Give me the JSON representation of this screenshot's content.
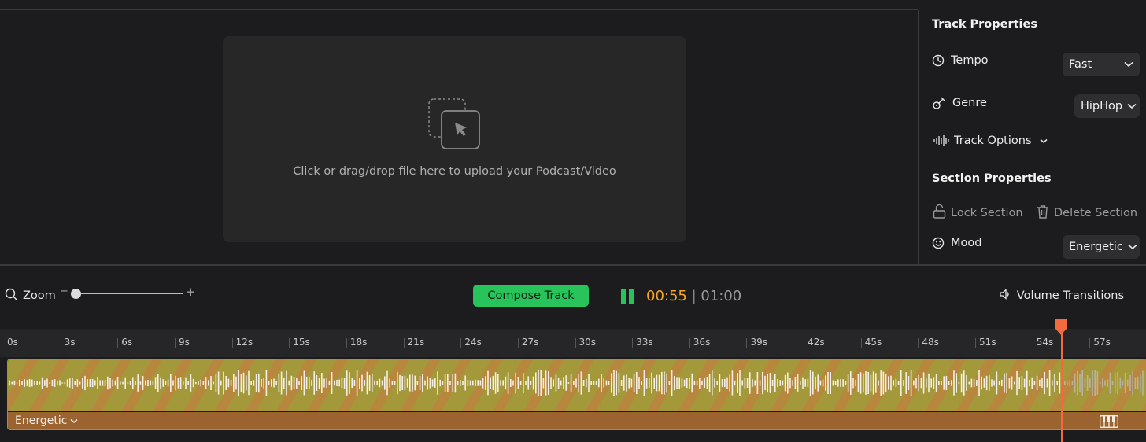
{
  "upload": {
    "prompt": "Click or drag/drop file here to upload your Podcast/Video"
  },
  "track_properties": {
    "title": "Track Properties",
    "tempo": {
      "label": "Tempo",
      "value": "Fast"
    },
    "genre": {
      "label": "Genre",
      "value": "HipHop"
    },
    "track_options_label": "Track Options"
  },
  "section_properties": {
    "title": "Section Properties",
    "lock_label": "Lock Section",
    "delete_label": "Delete Section",
    "mood": {
      "label": "Mood",
      "value": "Energetic"
    }
  },
  "controls": {
    "zoom_label": "Zoom",
    "zoom_minus": "−",
    "zoom_plus": "+",
    "compose_label": "Compose Track",
    "time_current": "00:55",
    "time_separator": " | ",
    "time_total": "01:00",
    "volume_label": "Volume Transitions"
  },
  "timeline": {
    "ticks": [
      "0s",
      "3s",
      "6s",
      "9s",
      "12s",
      "15s",
      "18s",
      "21s",
      "24s",
      "27s",
      "30s",
      "33s",
      "36s",
      "39s",
      "42s",
      "45s",
      "48s",
      "51s",
      "54s",
      "57s"
    ],
    "section_label": "Energetic",
    "playhead_seconds": 55,
    "duration_seconds": 60
  },
  "colors": {
    "accent_green": "#28c35a",
    "time_orange": "#f5a623",
    "playhead": "#f46a3f"
  }
}
